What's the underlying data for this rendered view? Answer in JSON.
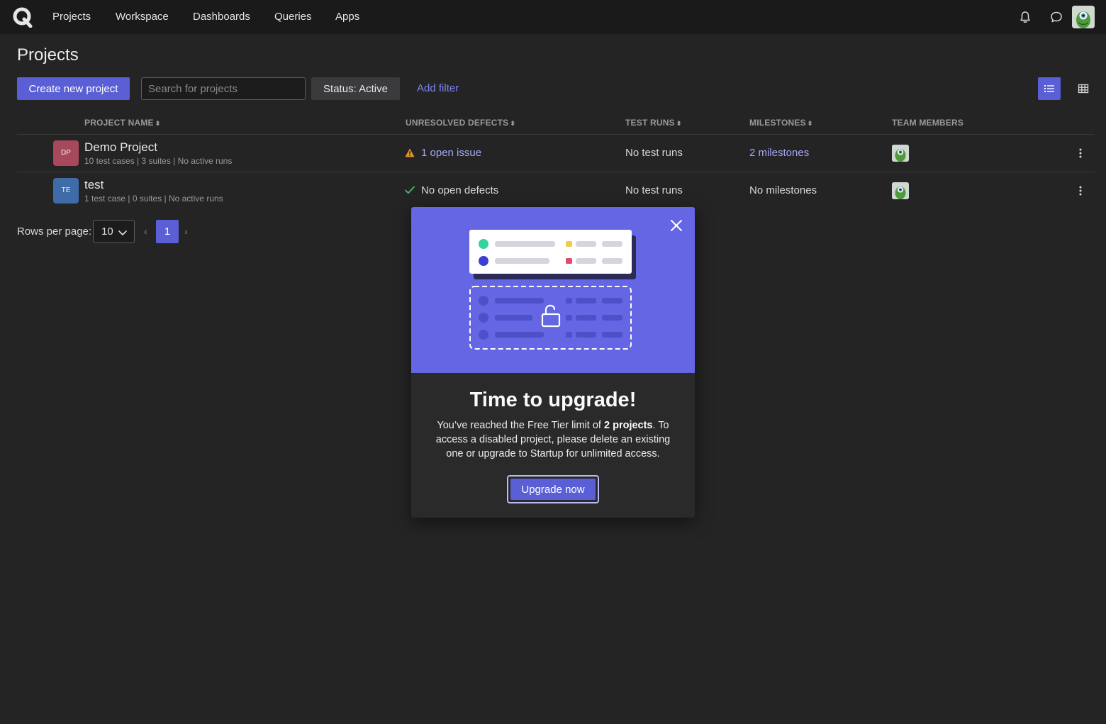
{
  "nav": {
    "logo_letter": "Q",
    "links": [
      "Projects",
      "Workspace",
      "Dashboards",
      "Queries",
      "Apps"
    ],
    "icons": [
      "bell-icon",
      "chat-icon"
    ]
  },
  "page": {
    "title": "Projects"
  },
  "toolbar": {
    "create_label": "Create new project",
    "search_placeholder": "Search for projects",
    "status_filter": "Status: Active",
    "add_filter": "Add filter"
  },
  "table": {
    "headers": {
      "project_name": "PROJECT NAME",
      "unresolved_defects": "UNRESOLVED DEFECTS",
      "test_runs": "TEST RUNS",
      "milestones": "MILESTONES",
      "team_members": "TEAM MEMBERS"
    },
    "rows": [
      {
        "initials": "DP",
        "avatar_color": "#a7485c",
        "name": "Demo Project",
        "meta": "10 test cases | 3 suites | No active runs",
        "defects": "1 open issue",
        "defects_icon": "warning-icon",
        "test_runs": "No test runs",
        "milestones": "2 milestones"
      },
      {
        "initials": "TE",
        "avatar_color": "#3f6ca8",
        "name": "test",
        "meta": "1 test case | 0 suites | No active runs",
        "defects": "No open defects",
        "defects_icon": "check-icon",
        "test_runs": "No test runs",
        "milestones": "No milestones"
      }
    ]
  },
  "pagination": {
    "rows_per_page_label": "Rows per page:",
    "rows_per_page": "10",
    "prev": "‹",
    "current_page": "1",
    "next": "›"
  },
  "modal": {
    "title": "Time to upgrade!",
    "body_before": "You’ve reached the Free Tier limit of ",
    "body_bold": "2 projects",
    "body_after": ". To access a disabled project, please delete an existing one or upgrade to Startup for unlimited access.",
    "button": "Upgrade now"
  },
  "colors": {
    "accent": "#5a5fd6",
    "modal_hero": "#6466e4",
    "warning": "#e0952a",
    "success": "#3fbf6b"
  }
}
